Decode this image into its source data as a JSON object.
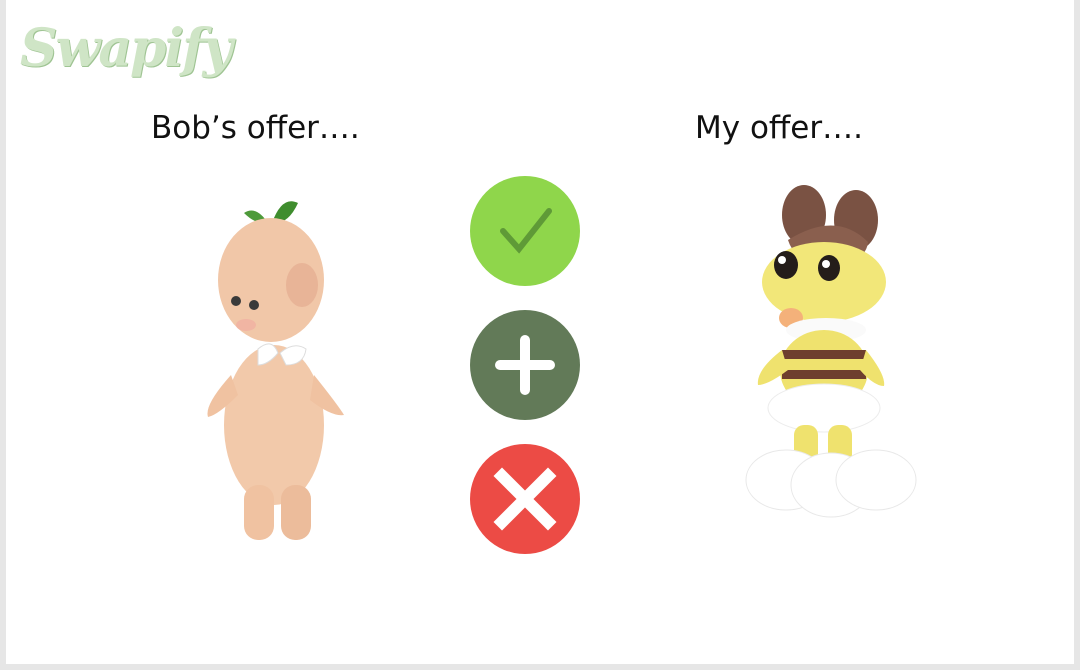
{
  "app": {
    "logo_text": "Swapify"
  },
  "offers": {
    "left_heading": "Bob’s offer….",
    "right_heading": "My offer…."
  },
  "actions": {
    "accept_icon": "checkmark-icon",
    "add_icon": "plus-icon",
    "reject_icon": "close-icon"
  },
  "colors": {
    "accept": "#8fd64b",
    "add": "#627a58",
    "reject": "#ec4b45",
    "logo": "#cfe5c6"
  }
}
